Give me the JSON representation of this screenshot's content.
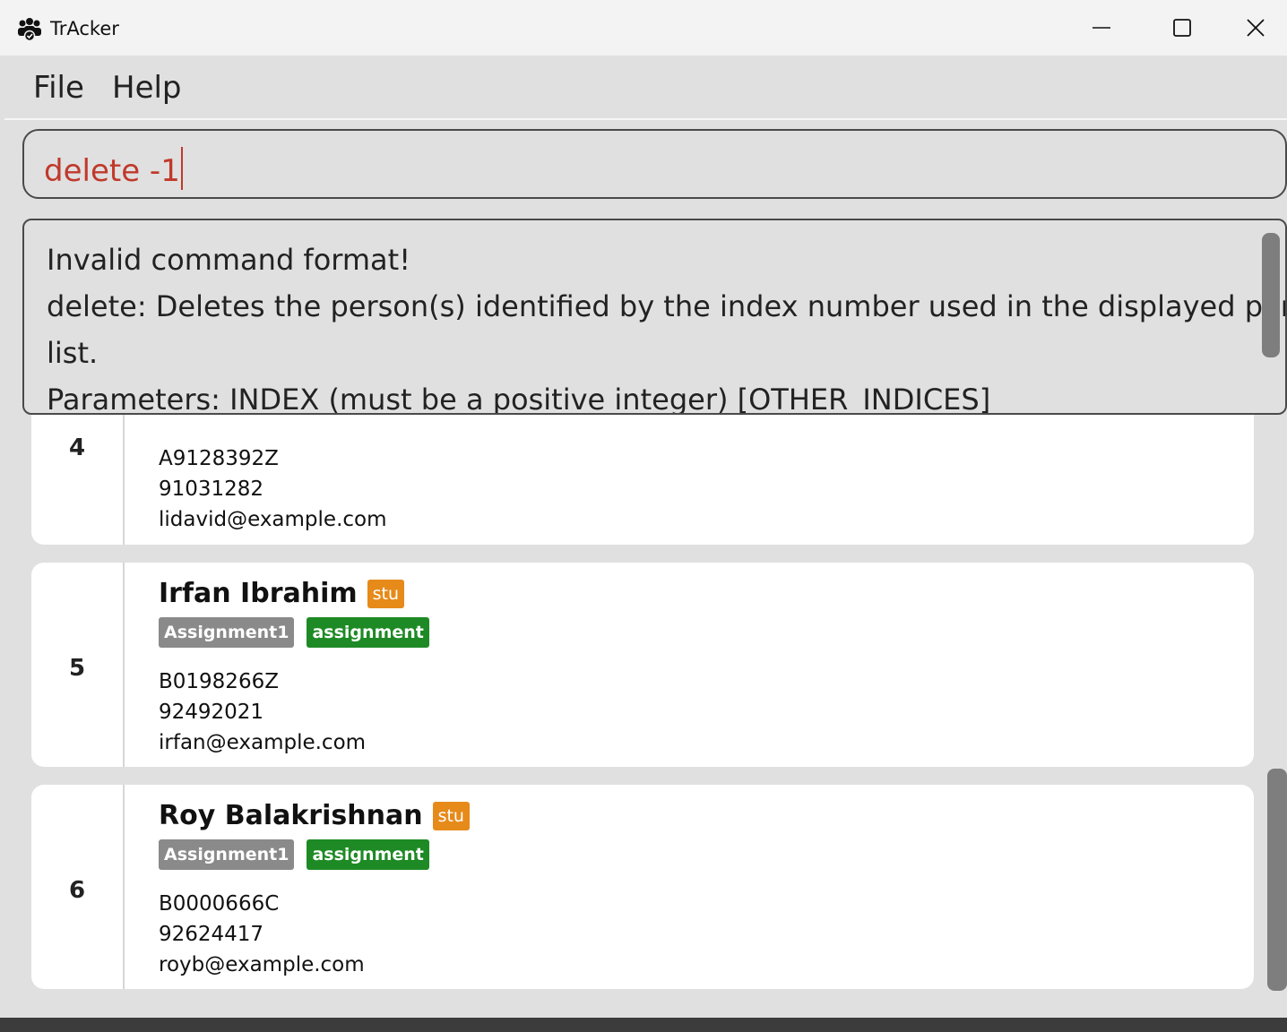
{
  "window": {
    "title": "TrAcker"
  },
  "menu": {
    "file": "File",
    "help": "Help"
  },
  "command": {
    "value": "delete -1"
  },
  "result": {
    "lines": [
      "Invalid command format!",
      "delete: Deletes the person(s) identified by the index number used in the displayed person",
      "list.",
      "Parameters: INDEX (must be a positive integer) [OTHER_INDICES]"
    ]
  },
  "persons": [
    {
      "index": "4",
      "id": "A9128392Z",
      "phone": "91031282",
      "email": "lidavid@example.com"
    },
    {
      "index": "5",
      "name": "Irfan Ibrahim",
      "role": "stu",
      "tags": [
        "Assignment1",
        "assignment"
      ],
      "id": "B0198266Z",
      "phone": "92492021",
      "email": "irfan@example.com"
    },
    {
      "index": "6",
      "name": "Roy Balakrishnan",
      "role": "stu",
      "tags": [
        "Assignment1",
        "assignment"
      ],
      "id": "B0000666C",
      "phone": "92624417",
      "email": "royb@example.com"
    }
  ],
  "colors": {
    "error_text": "#c0392b",
    "role_badge": "#e68a1a",
    "tag_grey": "#8a8a8a",
    "tag_green": "#1e8a25"
  },
  "icons": {
    "app": "people-group-icon",
    "minimize": "minimize-icon",
    "maximize": "maximize-icon",
    "close": "close-icon"
  }
}
